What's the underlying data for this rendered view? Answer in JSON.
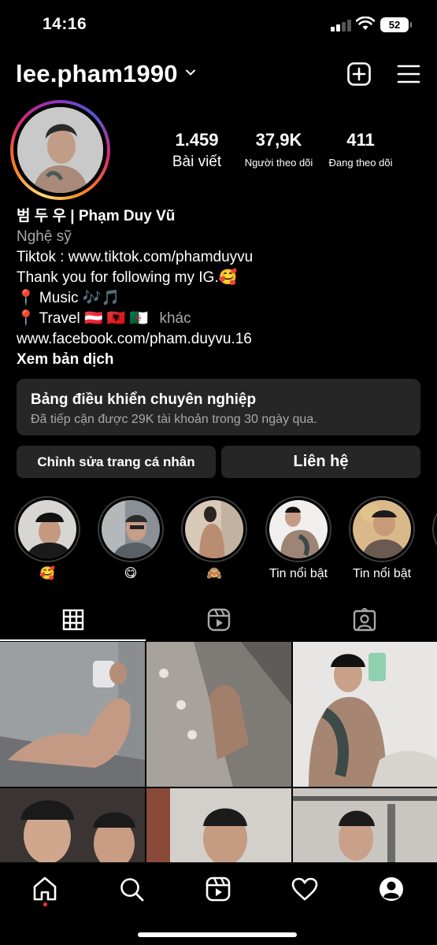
{
  "status_bar": {
    "time": "14:16",
    "battery": "52"
  },
  "header": {
    "username": "lee.pham1990"
  },
  "stats": [
    {
      "value": "1.459",
      "label": "Bài viết"
    },
    {
      "value": "37,9K",
      "label": "Người theo dõi"
    },
    {
      "value": "411",
      "label": "Đang theo dõi"
    }
  ],
  "bio": {
    "name": "범 두 우  | Phạm Duy Vũ",
    "category": "Nghệ sỹ",
    "lines": [
      "Tiktok : www.tiktok.com/phamduyvu",
      "Thank you for following my IG.🥰",
      "📍 Music 🎶🎵",
      "📍 Travel 🇦🇹 🇦🇱 🇩🇿"
    ],
    "more": "khác",
    "link": "www.facebook.com/pham.duyvu.16",
    "translate": "Xem bản dịch"
  },
  "dashboard": {
    "title": "Bảng điều khiển chuyên nghiệp",
    "subtitle": "Đã tiếp cận được 29K tài khoản trong 30 ngày qua."
  },
  "buttons": {
    "edit_profile": "Chỉnh sửa trang cá nhân",
    "contact": "Liên hệ"
  },
  "highlights": [
    {
      "label": "🥰"
    },
    {
      "label": "😋"
    },
    {
      "label": "🙈"
    },
    {
      "label": "Tin nổi bật"
    },
    {
      "label": "Tin nổi bật"
    }
  ],
  "tabs": [
    "grid-tab",
    "reels-tab",
    "tagged-tab"
  ],
  "bottom_nav": [
    "home-icon",
    "search-icon",
    "reels-icon",
    "heart-icon",
    "profile-icon"
  ],
  "colors": {
    "background": "#000000",
    "card": "#262626",
    "secondary_text": "#a8a8a8",
    "notification_dot": "#ff3040"
  }
}
